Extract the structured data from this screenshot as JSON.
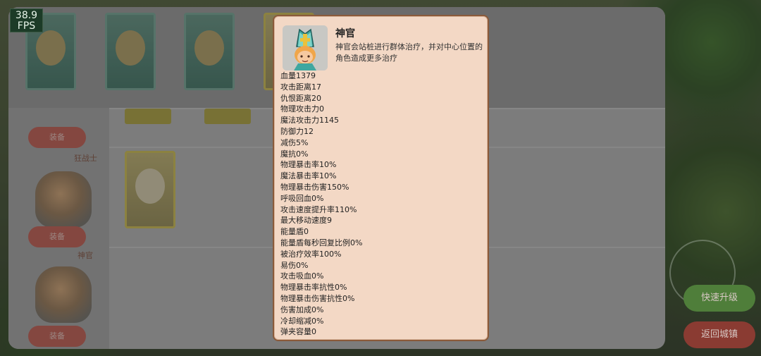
{
  "fps": {
    "value": "38.9",
    "label": "FPS"
  },
  "popup": {
    "title": "神官",
    "description": "神官会站桩进行群体治疗，并对中心位置的角色造成更多治疗",
    "stats": [
      "血量1379",
      "攻击距离17",
      "仇恨距离20",
      "物理攻击力0",
      "魔法攻击力1145",
      "防御力12",
      "减伤5%",
      "魔抗0%",
      "物理暴击率10%",
      "魔法暴击率10%",
      "物理暴击伤害150%",
      "呼吸回血0%",
      "攻击速度提升率110%",
      "最大移动速度9",
      "能量盾0",
      "能量盾每秒回复比例0%",
      "被治疗效率100%",
      "易伤0%",
      "攻击吸血0%",
      "物理暴击率抗性0%",
      "物理暴击伤害抗性0%",
      "伤害加成0%",
      "冷却缩减0%",
      "弹夹容量0"
    ]
  },
  "background": {
    "hero_names": [
      "狂战士",
      "神官"
    ],
    "equip_label": "装备",
    "right_buttons": {
      "top": "快速升级",
      "bottom": "返回城镇"
    }
  },
  "icons": [
    "priest-portrait-icon",
    "joystick-icon"
  ]
}
